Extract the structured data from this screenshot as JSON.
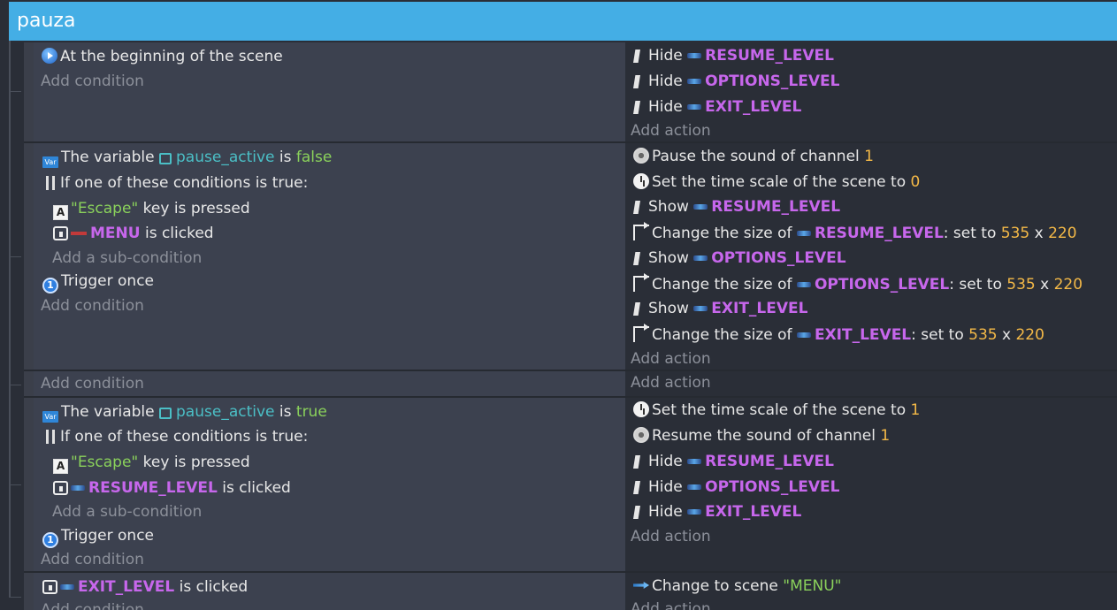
{
  "header": {
    "title": "pauza"
  },
  "common": {
    "add_condition": "Add condition",
    "add_action": "Add action",
    "add_subcondition": "Add a sub-condition",
    "or_label": "If one of these conditions is true:",
    "trigger_once": "Trigger once",
    "the_variable": "The variable",
    "is_word": "is",
    "is_clicked": "is clicked",
    "key_is_pressed": "key is pressed",
    "hide": "Hide",
    "show": "Show",
    "change_size_of": "Change the size of",
    "set_to": ": set to",
    "times": "x"
  },
  "event1": {
    "condition": "At the beginning of the scene",
    "actions": [
      {
        "verb": "Hide",
        "object": "RESUME_LEVEL"
      },
      {
        "verb": "Hide",
        "object": "OPTIONS_LEVEL"
      },
      {
        "verb": "Hide",
        "object": "EXIT_LEVEL"
      }
    ]
  },
  "event2": {
    "variable": "pause_active",
    "value": "false",
    "key": "\"Escape\"",
    "clicked_object": "MENU",
    "pause_sound": "Pause the sound of channel",
    "channel": "1",
    "time_scale": "Set the time scale of the scene to",
    "time_value": "0",
    "objects": [
      "RESUME_LEVEL",
      "OPTIONS_LEVEL",
      "EXIT_LEVEL"
    ],
    "width": "535",
    "height": "220"
  },
  "event3": {
    "variable": "pause_active",
    "value": "true",
    "key": "\"Escape\"",
    "clicked_object": "RESUME_LEVEL",
    "time_scale": "Set the time scale of the scene to",
    "time_value": "1",
    "resume_sound": "Resume the sound of channel",
    "channel": "1",
    "objects": [
      "RESUME_LEVEL",
      "OPTIONS_LEVEL",
      "EXIT_LEVEL"
    ]
  },
  "event4": {
    "clicked_object": "EXIT_LEVEL",
    "change_scene": "Change to scene",
    "scene_name": "\"MENU\""
  }
}
